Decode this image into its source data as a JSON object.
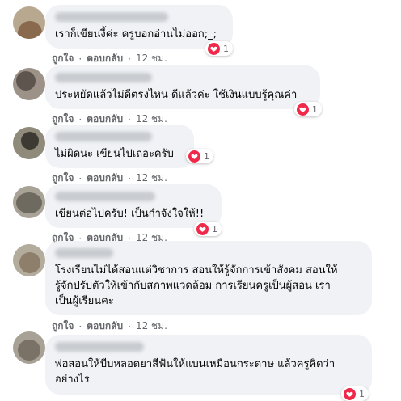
{
  "colors": {
    "bubble": "#f0f2f5",
    "text": "#050505",
    "meta": "#65676b",
    "like_heart": "#f02849"
  },
  "comments": [
    {
      "text": "เราก็เขียนงี้ค่ะ ครูบอกอ่านไม่ออก;_;",
      "like_label": "ถูกใจ",
      "reply_label": "ตอบกลับ",
      "time": "12 ชม.",
      "reaction_icon": "heart-icon",
      "reaction_count": "1"
    },
    {
      "text": "ประหยัดแล้วไม่ดีตรงไหน ดีแล้วค่ะ ใช้เงินแบบรู้คุณค่า",
      "like_label": "ถูกใจ",
      "reply_label": "ตอบกลับ",
      "time": "12 ชม.",
      "reaction_icon": "heart-icon",
      "reaction_count": "1"
    },
    {
      "text": "ไม่ผิดนะ เขียนไปเถอะครับ",
      "like_label": "ถูกใจ",
      "reply_label": "ตอบกลับ",
      "time": "12 ชม.",
      "reaction_icon": "heart-icon",
      "reaction_count": "1"
    },
    {
      "text": "เขียนต่อไปครับ! เป็นกำจังใจให้!!",
      "like_label": "ถูกใจ",
      "reply_label": "ตอบกลับ",
      "time": "12 ชม.",
      "reaction_icon": "heart-icon",
      "reaction_count": "1"
    },
    {
      "text": "โรงเรียนไม่ได้สอนแต่วิชาการ สอนให้รู้จักการเข้าสังคม สอนให้\nรู้จักปรับตัวให้เข้ากับสภาพแวดล้อม การเรียนครูเป็นผู้สอน เรา\nเป็นผู้เรียนคะ",
      "like_label": "ถูกใจ",
      "reply_label": "ตอบกลับ",
      "time": "12 ชม."
    },
    {
      "text": "พ่อสอนให้บีบหลอดยาสีฟันให้แบนเหมือนกระดาษ แล้วครูคิดว่า\nอย่างไร",
      "reaction_icon": "heart-icon",
      "reaction_count": "1"
    }
  ]
}
